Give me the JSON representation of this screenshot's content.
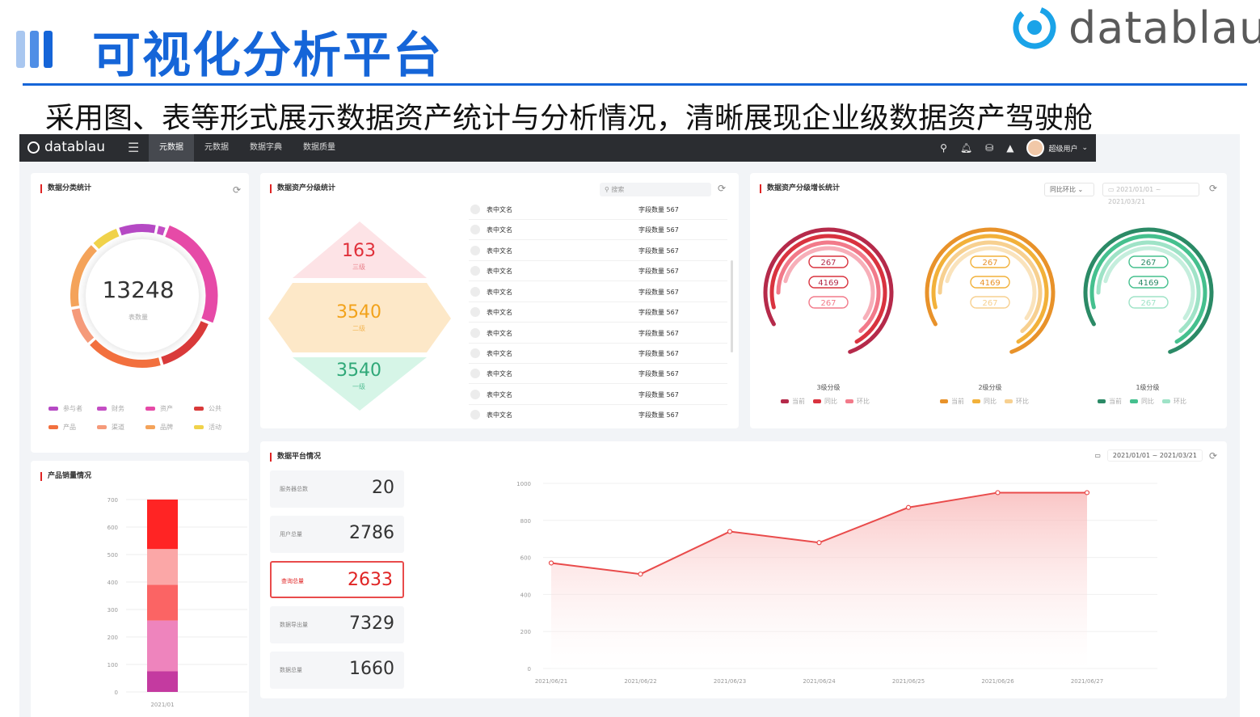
{
  "slide": {
    "title": "可视化分析平台",
    "brand": "datablau",
    "subtitle": "采用图、表等形式展示数据资产统计与分析情况，清晰展现企业级数据资产驾驶舱"
  },
  "app": {
    "logo": "datablau",
    "nav": [
      "元数据",
      "元数据",
      "数据字典",
      "数据质量"
    ],
    "user_name": "超级用户"
  },
  "colors": {
    "accent": "#1565d8",
    "nav_bg": "#2b2d31",
    "highlight": "#e02424"
  },
  "panel_category": {
    "title": "数据分类统计",
    "total": "13248",
    "total_label": "表数量",
    "legend": [
      {
        "label": "参与者",
        "color": "#b549c4"
      },
      {
        "label": "财务",
        "color": "#c44ec4"
      },
      {
        "label": "资产",
        "color": "#e64aa7"
      },
      {
        "label": "公共",
        "color": "#d93a3a"
      },
      {
        "label": "产品",
        "color": "#f2703e"
      },
      {
        "label": "渠道",
        "color": "#f59a7a"
      },
      {
        "label": "品牌",
        "color": "#f4a35a"
      },
      {
        "label": "活动",
        "color": "#f0d24a"
      }
    ]
  },
  "panel_levels": {
    "title": "数据资产分级统计",
    "search_placeholder": "搜索",
    "level3_value": "163",
    "level3_label": "三级",
    "level2_value": "3540",
    "level2_label": "二级",
    "level1_value": "3540",
    "level1_label": "一级",
    "rows": [
      {
        "name": "表中文名",
        "count_label": "字段数量",
        "count": "567"
      },
      {
        "name": "表中文名",
        "count_label": "字段数量",
        "count": "567"
      },
      {
        "name": "表中文名",
        "count_label": "字段数量",
        "count": "567"
      },
      {
        "name": "表中文名",
        "count_label": "字段数量",
        "count": "567"
      },
      {
        "name": "表中文名",
        "count_label": "字段数量",
        "count": "567"
      },
      {
        "name": "表中文名",
        "count_label": "字段数量",
        "count": "567"
      },
      {
        "name": "表中文名",
        "count_label": "字段数量",
        "count": "567"
      },
      {
        "name": "表中文名",
        "count_label": "字段数量",
        "count": "567"
      },
      {
        "name": "表中文名",
        "count_label": "字段数量",
        "count": "567"
      },
      {
        "name": "表中文名",
        "count_label": "字段数量",
        "count": "567"
      },
      {
        "name": "表中文名",
        "count_label": "字段数量",
        "count": "567"
      }
    ]
  },
  "panel_growth": {
    "title": "数据资产分级增长统计",
    "compare_select": "同比环比",
    "date_range": "2021/01/01 ~ 2021/03/21",
    "groups": [
      {
        "label": "3级分级",
        "values": [
          "267",
          "4169",
          "267"
        ],
        "legend": [
          "当前",
          "同比",
          "环比"
        ],
        "colors": [
          "#b52a4a",
          "#d9333f",
          "#f27a8a"
        ]
      },
      {
        "label": "2级分级",
        "values": [
          "267",
          "4169",
          "267"
        ],
        "legend": [
          "当前",
          "同比",
          "环比"
        ],
        "colors": [
          "#e8922a",
          "#f2b13a",
          "#f7d090"
        ]
      },
      {
        "label": "1级分级",
        "values": [
          "267",
          "4169",
          "267"
        ],
        "legend": [
          "当前",
          "同比",
          "环比"
        ],
        "colors": [
          "#2b8a66",
          "#45c08e",
          "#9fe3c7"
        ]
      }
    ]
  },
  "panel_sales": {
    "title": "产品销量情况",
    "y_ticks": [
      "700",
      "600",
      "500",
      "400",
      "300",
      "200",
      "100",
      "0"
    ],
    "x_label": "2021/01"
  },
  "panel_platform": {
    "title": "数据平台情况",
    "date_range": "2021/01/01 ~ 2021/03/21",
    "stats": [
      {
        "label": "服务器总数",
        "value": "20"
      },
      {
        "label": "用户总量",
        "value": "2786"
      },
      {
        "label": "查询总量",
        "value": "2633"
      },
      {
        "label": "数据导出量",
        "value": "7329"
      },
      {
        "label": "数据总量",
        "value": "1660"
      }
    ]
  },
  "chart_data": [
    {
      "type": "bar",
      "title": "产品销量情况",
      "stacked": true,
      "categories": [
        "2021/01"
      ],
      "ylim": [
        0,
        700
      ],
      "series": [
        {
          "values": [
            75
          ],
          "color": "#c43aa0"
        },
        {
          "values": [
            185
          ],
          "color": "#ee84bd"
        },
        {
          "values": [
            130
          ],
          "color": "#fb6464"
        },
        {
          "values": [
            130
          ],
          "color": "#fba7a7"
        },
        {
          "values": [
            180
          ],
          "color": "#ff2424"
        }
      ]
    },
    {
      "type": "area",
      "title": "数据平台情况",
      "x": [
        "2021/06/21",
        "2021/06/22",
        "2021/06/23",
        "2021/06/24",
        "2021/06/25",
        "2021/06/26",
        "2021/06/27"
      ],
      "y_ticks": [
        "1000",
        "800",
        "600",
        "400",
        "200",
        "0"
      ],
      "ylim": [
        0,
        1000
      ],
      "values": [
        570,
        510,
        740,
        680,
        870,
        950,
        950
      ],
      "color": "#e94b4b"
    },
    {
      "type": "pie",
      "title": "数据分类统计",
      "categories": [
        "参与者",
        "财务",
        "资产",
        "公共",
        "产品",
        "渠道",
        "品牌",
        "活动"
      ],
      "values": [
        8,
        2,
        23,
        13,
        16,
        8,
        14,
        6
      ]
    }
  ]
}
